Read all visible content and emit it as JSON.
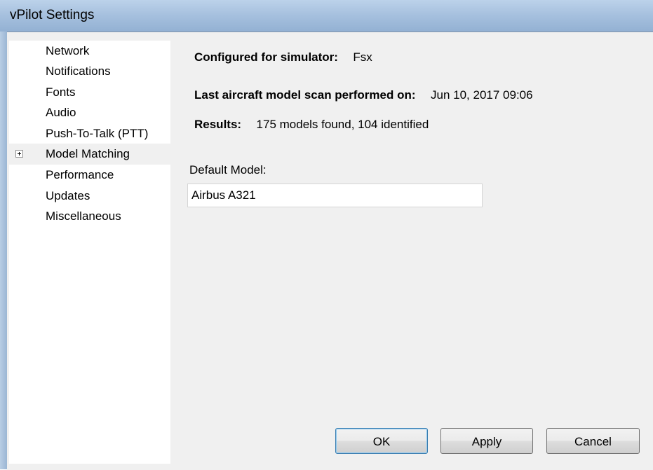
{
  "window": {
    "title": "vPilot Settings"
  },
  "nav": {
    "items": [
      {
        "label": "Network"
      },
      {
        "label": "Notifications"
      },
      {
        "label": "Fonts"
      },
      {
        "label": "Audio"
      },
      {
        "label": "Push-To-Talk (PTT)"
      },
      {
        "label": "Model Matching",
        "expander": "plus-icon",
        "selected": true
      },
      {
        "label": "Performance"
      },
      {
        "label": "Updates"
      },
      {
        "label": "Miscellaneous"
      }
    ]
  },
  "model_matching": {
    "simulator_label": "Configured for simulator:",
    "simulator_value": "Fsx",
    "scan_label": "Last aircraft model scan performed on:",
    "scan_value": "Jun 10, 2017 09:06",
    "results_label": "Results:",
    "results_value": "175 models found, 104 identified",
    "default_model_label": "Default Model:",
    "default_model_value": "Airbus A321"
  },
  "buttons": {
    "ok": "OK",
    "apply": "Apply",
    "cancel": "Cancel"
  },
  "colors": {
    "titlebar": "#a7c1df",
    "background": "#f0f0f0",
    "default_button_border": "#3c7fb1"
  }
}
